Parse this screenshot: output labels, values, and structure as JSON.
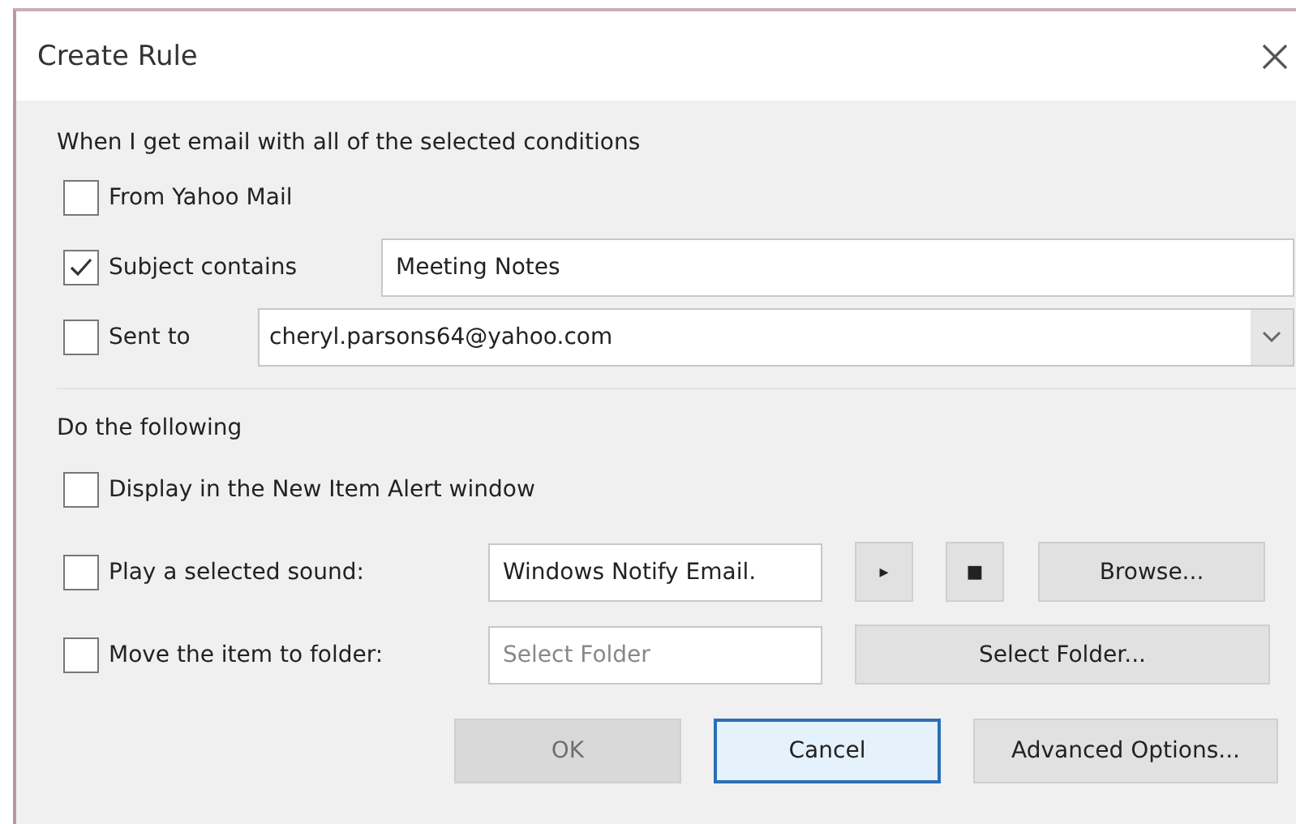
{
  "window": {
    "title": "Create Rule"
  },
  "conditions": {
    "heading": "When I get email with all of the selected conditions",
    "rows": [
      {
        "kind": "plain",
        "label": "From Yahoo Mail",
        "checked": false
      },
      {
        "kind": "text",
        "label": "Subject contains",
        "checked": true,
        "value": "Meeting Notes"
      },
      {
        "kind": "combo",
        "label": "Sent to",
        "checked": false,
        "value": "cheryl.parsons64@yahoo.com"
      }
    ]
  },
  "actions": {
    "heading": "Do the following",
    "rows": [
      {
        "kind": "plain",
        "label": "Display in the New Item Alert window",
        "checked": false
      },
      {
        "kind": "sound",
        "label": "Play a selected sound:",
        "checked": false,
        "value": "Windows Notify Email.",
        "play": "▸",
        "stop": "■",
        "button": "Browse..."
      },
      {
        "kind": "folder",
        "label": "Move the item to folder:",
        "checked": false,
        "placeholder": "Select Folder",
        "button": "Select Folder..."
      }
    ]
  },
  "buttons": [
    {
      "label": "OK",
      "disabled": true,
      "focused": false
    },
    {
      "label": "Cancel",
      "disabled": false,
      "focused": true
    },
    {
      "label": "Advanced Options...",
      "disabled": false,
      "focused": false
    }
  ]
}
